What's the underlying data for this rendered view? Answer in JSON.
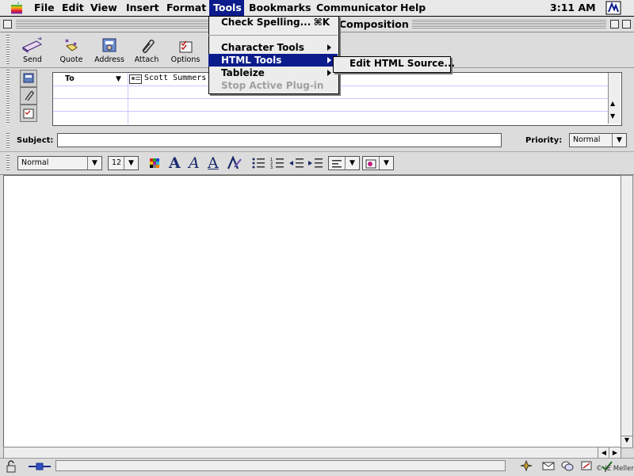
{
  "menubar": {
    "items": [
      "File",
      "Edit",
      "View",
      "Insert",
      "Format",
      "Tools",
      "Bookmarks",
      "Communicator",
      "Help"
    ],
    "active": "Tools",
    "clock": "3:11 AM"
  },
  "window": {
    "title": "Composition"
  },
  "toolbar": {
    "buttons": [
      {
        "label": "Send",
        "icon": "send-icon"
      },
      {
        "label": "Quote",
        "icon": "quote-icon"
      },
      {
        "label": "Address",
        "icon": "address-book-icon"
      },
      {
        "label": "Attach",
        "icon": "paperclip-icon"
      },
      {
        "label": "Options",
        "icon": "options-icon"
      }
    ]
  },
  "address": {
    "field_type": "To",
    "recipient": "Scott Summers"
  },
  "subject": {
    "label": "Subject:",
    "value": ""
  },
  "priority": {
    "label": "Priority:",
    "value": "Normal"
  },
  "format": {
    "paragraph_style": "Normal",
    "font_size": "12"
  },
  "tools_menu": {
    "items": [
      {
        "label": "Check Spelling...",
        "shortcut": "⌘K",
        "state": "normal"
      },
      {
        "label": "Character Tools",
        "submenu": true,
        "state": "normal"
      },
      {
        "label": "HTML Tools",
        "submenu": true,
        "state": "highlighted"
      },
      {
        "label": "Tableize",
        "submenu": true,
        "state": "normal"
      },
      {
        "label": "Stop Active Plug-in",
        "state": "disabled"
      }
    ]
  },
  "html_tools_submenu": {
    "items": [
      {
        "label": "Edit HTML Source..."
      }
    ]
  },
  "status": {
    "credit": "© JE Meller"
  },
  "colors": {
    "highlight": "#0c1c8c",
    "menu_bg": "#ececec",
    "chrome": "#dcdcdc"
  }
}
